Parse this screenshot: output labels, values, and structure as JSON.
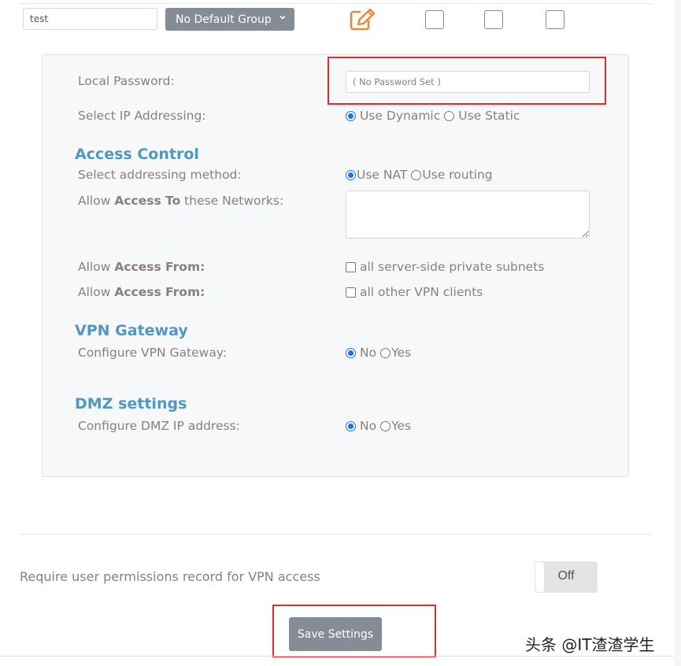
{
  "user_row": {
    "username": "test",
    "group_select": {
      "selected": "No Default Group"
    },
    "edit_icon": "pencil-square-icon",
    "checkboxes": [
      false,
      false,
      false
    ]
  },
  "panel": {
    "local_password": {
      "label": "Local Password:",
      "placeholder": "( No Password Set )",
      "value": ""
    },
    "ip_addressing": {
      "label": "Select IP Addressing:",
      "options": [
        {
          "label": "Use Dynamic",
          "selected": true
        },
        {
          "label": "Use Static",
          "selected": false
        }
      ]
    },
    "access_control": {
      "title": "Access Control",
      "addressing_method": {
        "label": "Select addressing method:",
        "options": [
          {
            "label": "Use NAT",
            "selected": true
          },
          {
            "label": "Use routing",
            "selected": false
          }
        ]
      },
      "access_to": {
        "label_prefix": "Allow",
        "label_bold": "Access To",
        "label_suffix": "these Networks:",
        "value": ""
      },
      "access_from_1": {
        "label_prefix": "Allow",
        "label_bold": "Access From:",
        "option": "all server-side private subnets",
        "checked": false
      },
      "access_from_2": {
        "label_prefix": "Allow",
        "label_bold": "Access From:",
        "option": "all other VPN clients",
        "checked": false
      }
    },
    "vpn_gateway": {
      "title": "VPN Gateway",
      "label": "Configure VPN Gateway:",
      "options": [
        {
          "label": "No",
          "selected": true
        },
        {
          "label": "Yes",
          "selected": false
        }
      ]
    },
    "dmz": {
      "title": "DMZ settings",
      "label": "Configure DMZ IP address:",
      "options": [
        {
          "label": "No",
          "selected": true
        },
        {
          "label": "Yes",
          "selected": false
        }
      ]
    }
  },
  "permissions": {
    "label": "Require user permissions record for VPN access",
    "toggle_state": "Off"
  },
  "save_button": "Save Settings",
  "watermark": "头条 @IT渣渣学生",
  "colors": {
    "section_title": "#4e98c6",
    "edit_icon": "#e8873a",
    "radio_selected": "#1a73e8",
    "highlight_box": "#e8262b",
    "button_bg": "#868c94"
  }
}
